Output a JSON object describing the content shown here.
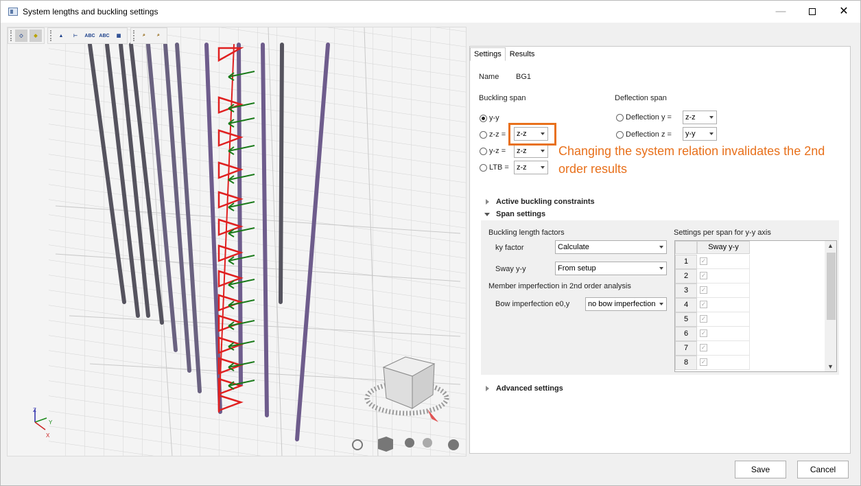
{
  "window": {
    "title": "System lengths and buckling settings",
    "minimize": "—",
    "close": "✕"
  },
  "toolbar": {
    "group1": [
      "solid-view-icon",
      "shaded-view-icon"
    ],
    "group2": [
      "member-labels-icon",
      "node-labels-icon",
      "abc-labels-icon",
      "abc-values-icon",
      "table-view-icon"
    ],
    "group3": [
      "zoom-region-icon",
      "zoom-region-settings-icon"
    ]
  },
  "viewport": {
    "axis": {
      "z": "Z",
      "y": "Y",
      "x": "X"
    },
    "bottom_icons": [
      "zoom-icon",
      "view-cube-icon",
      "rotate-icon",
      "rotate-alt-icon",
      "settings-icon"
    ]
  },
  "tabs": [
    "Settings",
    "Results"
  ],
  "settings": {
    "name_label": "Name",
    "name_value": "BG1",
    "buckling_span_label": "Buckling span",
    "deflection_span_label": "Deflection span",
    "buckling_rows": [
      {
        "label": "y-y",
        "checked": true,
        "value": ""
      },
      {
        "label": "z-z =",
        "checked": false,
        "value": "z-z"
      },
      {
        "label": "y-z =",
        "checked": false,
        "value": "z-z"
      },
      {
        "label": "LTB =",
        "checked": false,
        "value": "z-z"
      }
    ],
    "deflection_rows": [
      {
        "label": "Deflection y =",
        "value": "z-z"
      },
      {
        "label": "Deflection z =",
        "value": "y-y"
      }
    ]
  },
  "callout": "Changing the system relation invalidates the 2nd order results",
  "sections": {
    "active_buckling": "Active buckling constraints",
    "span_settings": "Span settings",
    "advanced": "Advanced settings"
  },
  "span": {
    "factors_label": "Buckling length factors",
    "ky_label": "ky factor",
    "ky_value": "Calculate",
    "sway_label": "Sway y-y",
    "sway_value": "From setup",
    "imperfection_label": "Member imperfection in 2nd order analysis",
    "bow_label": "Bow imperfection e0,y",
    "bow_value": "no bow imperfection",
    "per_span_label": "Settings per span for y-y axis",
    "grid_header": "Sway y-y",
    "rows": [
      "1",
      "2",
      "3",
      "4",
      "5",
      "6",
      "7",
      "8"
    ]
  },
  "buttons": {
    "save": "Save",
    "cancel": "Cancel"
  },
  "colors": {
    "accent": "#e8701b",
    "load_red": "#e02020",
    "arrow_green": "#1a7a1a",
    "member_purple": "#6e5c8c"
  }
}
